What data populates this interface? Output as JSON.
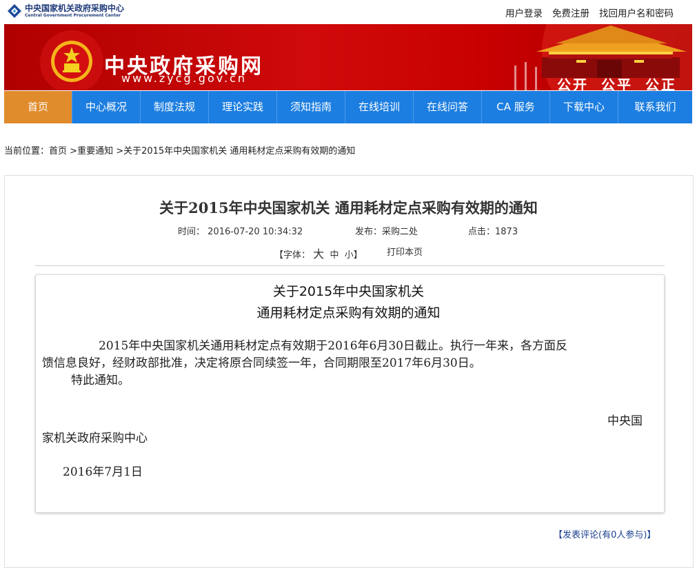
{
  "topbar": {
    "logo_cn": "中央国家机关政府采购中心",
    "logo_en": "Central Government Procurement Center",
    "links": [
      "用户登录",
      "免费注册",
      "找回用户名和密码"
    ]
  },
  "banner": {
    "site_title": "中央政府采购网",
    "site_url": "www.zycg.gov.cn",
    "slogan": [
      "公开",
      "公平",
      "公正"
    ]
  },
  "nav": {
    "items": [
      "首页",
      "中心概况",
      "制度法规",
      "理论实践",
      "须知指南",
      "在线培训",
      "在线问答",
      "CA 服务",
      "下载中心",
      "联系我们"
    ],
    "active": "首页"
  },
  "breadcrumb": {
    "prefix": "当前位置：",
    "items": [
      "首页",
      ">重要通知",
      ">关于2015年中央国家机关 通用耗材定点采购有效期的通知"
    ]
  },
  "article": {
    "title": "关于2015年中央国家机关 通用耗材定点采购有效期的通知",
    "time_label": "时间：",
    "time_value": "2016-07-20 10:34:32",
    "publisher_label": "发布：",
    "publisher_value": "采购二处",
    "hits_label": "点击：",
    "hits_value": "1873",
    "font_open": "【字体：",
    "font_large": "大",
    "font_medium": "中",
    "font_small": "小",
    "font_close": "】",
    "print_label": "打印本页"
  },
  "document": {
    "title_line1": "关于2015年中央国家机关",
    "title_line2": "通用耗材定点采购有效期的通知",
    "para1_line1": "2015年中央国家机关通用耗材定点有效期于2016年6月30日截止。执行一年来，各方面反",
    "para1_line2": "馈信息良好，经财政部批准，决定将原合同续签一年，合同期限至2017年6月30日。",
    "para2": "特此通知。",
    "sign_line1": "中央国",
    "sign_line2": "家机关政府采购中心",
    "date": "2016年7月1日"
  },
  "comment": {
    "label": "【发表评论(有0人参与)】"
  },
  "colors": {
    "nav_bg": "#1c7ee0",
    "nav_active": "#e08b2c",
    "banner_red": "#c80000",
    "comment_link": "#1a3f8f"
  }
}
